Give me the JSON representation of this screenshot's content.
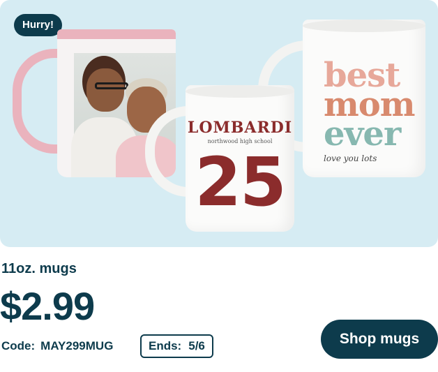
{
  "badge": {
    "label": "Hurry!"
  },
  "mugs": {
    "jersey": {
      "name_text": "LOMBARDI",
      "subtext": "northwood high school",
      "number": "25"
    },
    "mom": {
      "line1": "best",
      "line2": "mom",
      "line3": "ever",
      "script": "love you lots"
    }
  },
  "product": {
    "title": "11oz. mugs",
    "price": "$2.99"
  },
  "promo": {
    "code_label": "Code:",
    "code_value": "MAY299MUG",
    "ends_label": "Ends:",
    "ends_value": "5/6"
  },
  "cta": {
    "label": "Shop mugs"
  },
  "colors": {
    "primary": "#0d3b4c",
    "hero_bg": "#d6ecf3",
    "accent_pink": "#eab3bd",
    "jersey_red": "#8b2c2c"
  }
}
